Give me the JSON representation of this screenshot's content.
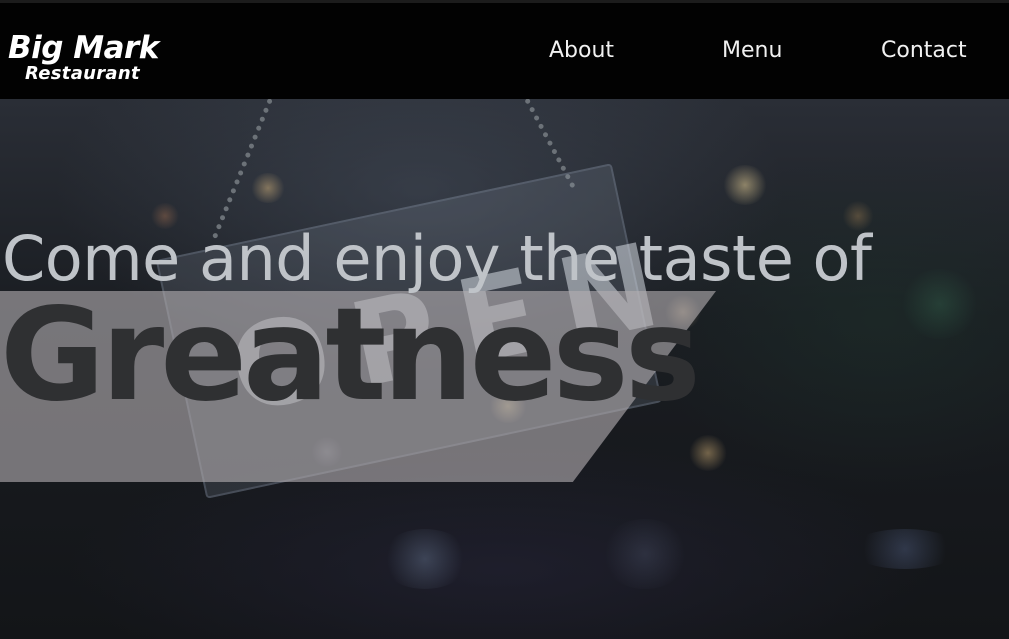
{
  "header": {
    "logo_main": "Big Mark",
    "logo_sub": "Restaurant"
  },
  "nav": {
    "items": [
      {
        "label": "About"
      },
      {
        "label": "Menu"
      },
      {
        "label": "Contact"
      }
    ]
  },
  "hero": {
    "sign_text": "OPEN",
    "tagline": "Come and enjoy the taste of",
    "headline": "Greatness"
  },
  "colors": {
    "header_bg": "#020202",
    "nav_text": "#f1f1f1",
    "banner": "#b2acb0",
    "headline_text": "#2f3032",
    "tagline_text": "#bfc3c8"
  }
}
